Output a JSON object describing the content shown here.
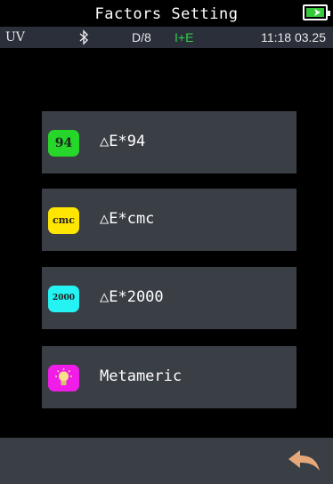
{
  "header": {
    "title": "Factors Setting"
  },
  "status": {
    "illuminant": "UV",
    "geometry": "D/8",
    "mode": "I+E",
    "time": "11:18 03.25"
  },
  "menu": [
    {
      "badge": "94",
      "badge_color": "#27d62a",
      "label": "△E*94"
    },
    {
      "badge": "cmc",
      "badge_color": "#ffe600",
      "label": "△E*cmc"
    },
    {
      "badge": "2000",
      "badge_color": "#25f2f2",
      "label": "△E*2000"
    },
    {
      "badge_icon": "bulb-icon",
      "badge_color": "#f01de8",
      "label": "Metameric"
    }
  ],
  "colors": {
    "battery": "#35c93b",
    "mode": "#2fd14b",
    "back_arrow": "#e6a878"
  }
}
